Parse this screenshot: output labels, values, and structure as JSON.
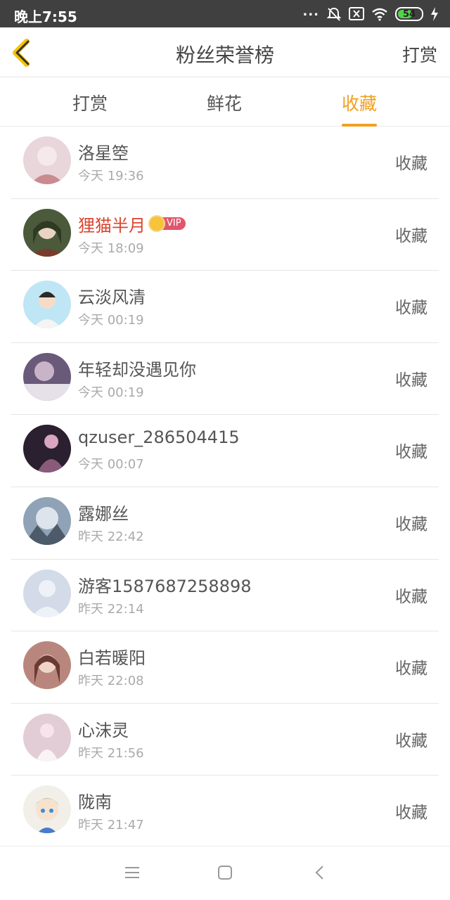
{
  "status_bar": {
    "time": "晚上7:55",
    "dots": "...",
    "battery": "54"
  },
  "header": {
    "title": "粉丝荣誉榜",
    "right_action": "打赏"
  },
  "tabs": [
    {
      "label": "打赏",
      "active": false
    },
    {
      "label": "鲜花",
      "active": false
    },
    {
      "label": "收藏",
      "active": true
    }
  ],
  "colors": {
    "accent": "#f0a020",
    "vip_name": "#d9452f",
    "vip_badge": "#e0566c"
  },
  "list": [
    {
      "name": "洛星箜",
      "time": "今天 19:36",
      "action": "收藏",
      "vip": false,
      "avatar_color": "#e8d6da"
    },
    {
      "name": "狸猫半月",
      "time": "今天 18:09",
      "action": "收藏",
      "vip": true,
      "vip_label": "VIP",
      "avatar_color": "#4a5a3a"
    },
    {
      "name": "云淡风清",
      "time": "今天 00:19",
      "action": "收藏",
      "vip": false,
      "avatar_color": "#bfe6f5"
    },
    {
      "name": "年轻却没遇见你",
      "time": "今天 00:19",
      "action": "收藏",
      "vip": false,
      "avatar_color": "#6a5a7a"
    },
    {
      "name": "qzuser_286504415",
      "time": "今天 00:07",
      "action": "收藏",
      "vip": false,
      "avatar_color": "#2a2030"
    },
    {
      "name": "露娜丝",
      "time": "昨天 22:42",
      "action": "收藏",
      "vip": false,
      "avatar_color": "#8fa2b6"
    },
    {
      "name": "游客1587687258898",
      "time": "昨天 22:14",
      "action": "收藏",
      "vip": false,
      "avatar_color": "#d3dbe8"
    },
    {
      "name": "白若暖阳",
      "time": "昨天 22:08",
      "action": "收藏",
      "vip": false,
      "avatar_color": "#b9867e"
    },
    {
      "name": "心沫灵",
      "time": "昨天 21:56",
      "action": "收藏",
      "vip": false,
      "avatar_color": "#e2ccd6"
    },
    {
      "name": "陇南",
      "time": "昨天 21:47",
      "action": "收藏",
      "vip": false,
      "avatar_color": "#f1efe8"
    }
  ],
  "nav": {
    "menu_icon": "menu-icon",
    "home_icon": "home-square-icon",
    "back_icon": "back-arrow-icon"
  }
}
